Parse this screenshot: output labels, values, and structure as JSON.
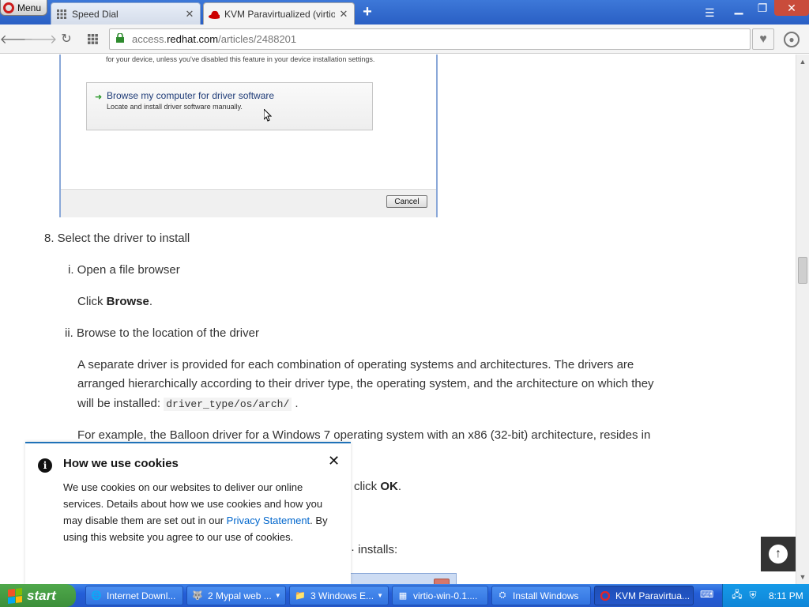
{
  "browser": {
    "menu_label": "Menu",
    "tabs": [
      {
        "title": "Speed Dial",
        "icon": "grid-icon",
        "active": false
      },
      {
        "title": "KVM Paravirtualized (virtio) Dr",
        "icon": "redhat-icon",
        "active": true
      }
    ],
    "url": {
      "prefix": "access.",
      "domain": "redhat.com",
      "path": "/articles/2488201"
    }
  },
  "article": {
    "embedded_dialog": {
      "partial_text": "for your device, unless you've disabled this feature in your device installation settings.",
      "option_title": "Browse my computer for driver software",
      "option_subtitle": "Locate and install driver software manually.",
      "cancel_label": "Cancel"
    },
    "step8": "8. Select the driver to install",
    "sub_i": "i. Open a file browser",
    "click_prefix": "Click ",
    "browse_bold": "Browse",
    "click_suffix": ".",
    "sub_ii": "ii. Browse to the location of the driver",
    "para1_line1": "A separate driver is provided for each combination of operating systems and architectures. The drivers are",
    "para1_line2": "arranged hierarchically according to their driver type, the operating system, and the architecture on which they",
    "para1_line3_prefix": "will be installed: ",
    "para1_code": "driver_type/os/arch/",
    "para1_line3_suffix": ".",
    "para2": "For example, the Balloon driver for a Windows 7 operating system with an x86 (32-bit) architecture, resides in",
    "frag_click": "click ",
    "frag_ok": "OK",
    "frag_ok_suffix": ".",
    "frag_installs": "· installs:"
  },
  "cookie_banner": {
    "heading": "How we use cookies",
    "body_part1": "We use cookies on our websites to deliver our online services. Details about how we use cookies and how you may disable them are set out in our ",
    "link": "Privacy Statement",
    "body_part2": ". By using this website you agree to our use of cookies."
  },
  "taskbar": {
    "start_label": "start",
    "items": [
      {
        "label": "Internet Downl...",
        "icon": "idm-icon",
        "dropdown": false,
        "active": false
      },
      {
        "label": "2 Mypal web ...",
        "icon": "mypal-icon",
        "dropdown": true,
        "active": false
      },
      {
        "label": "3 Windows E...",
        "icon": "folder-icon",
        "dropdown": true,
        "active": false
      },
      {
        "label": "virtio-win-0.1....",
        "icon": "archive-icon",
        "dropdown": false,
        "active": false
      },
      {
        "label": "Install Windows",
        "icon": "install-icon",
        "dropdown": false,
        "active": false
      },
      {
        "label": "KVM Paravirtua...",
        "icon": "opera-icon",
        "dropdown": false,
        "active": true
      }
    ],
    "clock": "8:11 PM"
  }
}
